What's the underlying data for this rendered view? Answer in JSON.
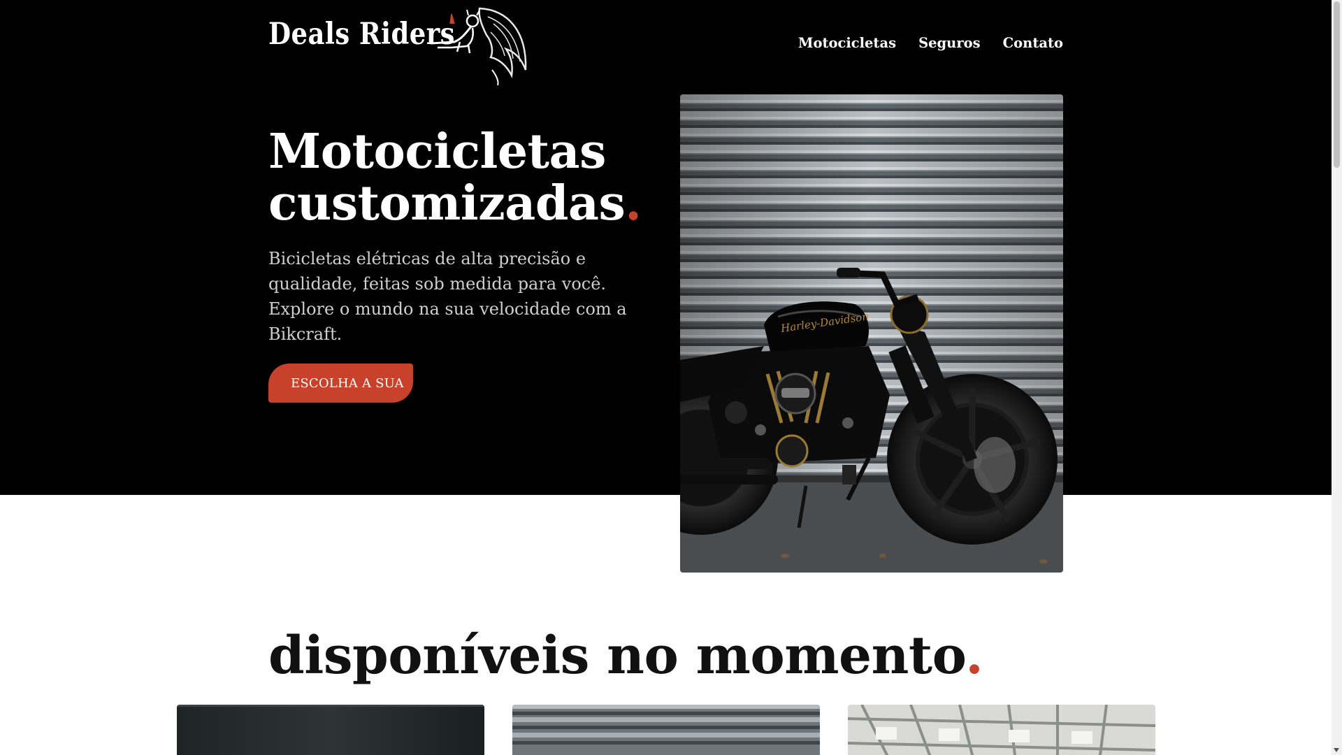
{
  "header": {
    "logo_text": "Deals Riders",
    "nav": [
      "Motocicletas",
      "Seguros",
      "Contato"
    ]
  },
  "hero": {
    "title_line1": "Motocicletas",
    "title_line2": "customizadas",
    "title_dot": ".",
    "description_line1": "Bicicletas elétricas de alta precisão e qualidade, feitas sob medida para você.",
    "description_line2": "Explore o mundo na sua velocidade com a Bikcraft.",
    "cta_label": "ESCOLHA A SUA"
  },
  "section": {
    "title": "disponíveis no momento",
    "title_dot": "."
  },
  "colors": {
    "accent": "#c8412a",
    "background_dark": "#000000"
  },
  "icons": {
    "logo_mascot": "devil-mascot-icon",
    "hero_image": "motorcycle-photo",
    "scroll_arrow": "chevron-down-icon"
  }
}
